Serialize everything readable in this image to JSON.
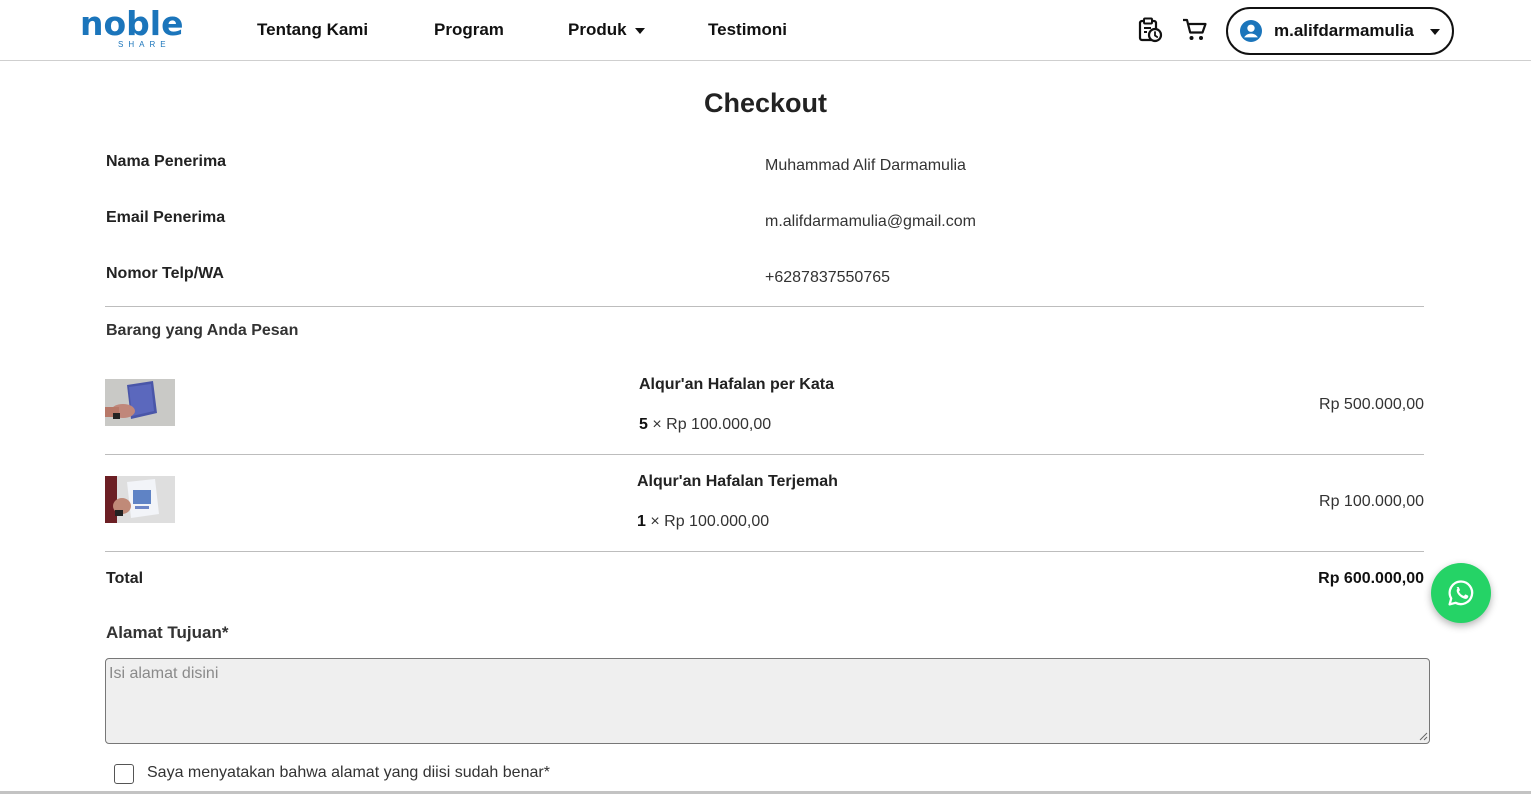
{
  "nav": {
    "logo_main": "noble",
    "logo_sub": "SHARE",
    "links": [
      {
        "label": "Tentang Kami"
      },
      {
        "label": "Program"
      },
      {
        "label": "Produk"
      },
      {
        "label": "Testimoni"
      }
    ],
    "history_icon": "clipboard-clock-icon",
    "cart_icon": "cart-icon",
    "user": {
      "name": "m.alifdarmamulia",
      "icon": "account-circle-icon"
    }
  },
  "page": {
    "title": "Checkout"
  },
  "recipient": {
    "name_label": "Nama Penerima",
    "name_value": "Muhammad Alif Darmamulia",
    "email_label": "Email Penerima",
    "email_value": "m.alifdarmamulia@gmail.com",
    "phone_label": "Nomor Telp/WA",
    "phone_value": "+6287837550765"
  },
  "order": {
    "section_label": "Barang yang Anda Pesan",
    "items": [
      {
        "name": "Alqur'an Hafalan per Kata",
        "qty": "5",
        "times": "×",
        "price": "Rp 100.000,00",
        "subtotal": "Rp 500.000,00"
      },
      {
        "name": "Alqur'an Hafalan Terjemah",
        "qty": "1",
        "times": "×",
        "price": "Rp 100.000,00",
        "subtotal": "Rp 100.000,00"
      }
    ],
    "total_label": "Total",
    "total_value": "Rp 600.000,00"
  },
  "address": {
    "label": "Alamat Tujuan*",
    "value": "",
    "placeholder": "Isi alamat disini"
  },
  "confirm": {
    "label": "Saya menyatakan bahwa alamat yang diisi sudah benar*",
    "checked": false
  },
  "whatsapp": {
    "icon": "whatsapp-icon"
  },
  "colors": {
    "brand": "#1b75bb",
    "whatsapp": "#25d366"
  }
}
